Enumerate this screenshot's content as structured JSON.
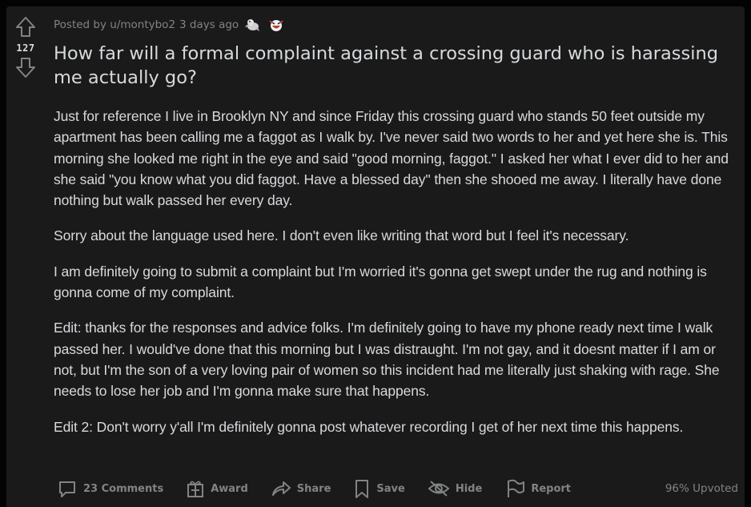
{
  "post": {
    "score": "127",
    "posted_by": "Posted by u/montybo2",
    "age": "3 days ago",
    "title": "How far will a formal complaint against a crossing guard who is harassing me actually go?",
    "paragraphs": [
      "Just for reference I live in Brooklyn NY and since Friday this crossing guard who stands 50 feet outside my apartment has been calling me a faggot as I walk by. I've never said two words to her and yet here she is. This morning she looked me right in the eye and said \"good morning, faggot.\" I asked her what I ever did to her and she said \"you know what you did faggot. Have a blessed day\" then she shooed me away. I literally have done nothing but walk passed her every day.",
      "Sorry about the language used here. I don't even like writing that word but I feel it's necessary.",
      "I am definitely going to submit a complaint but I'm worried it's gonna get swept under the rug and nothing is gonna come of my complaint.",
      "Edit: thanks for the responses and advice folks. I'm definitely going to have my phone ready next time I walk passed her. I would've done that this morning but I was distraught. I'm not gay, and it doesnt matter if I am or not, but I'm the son of a very loving pair of women so this incident had me literally just shaking with rage. She needs to lose her job and I'm gonna make sure that happens.",
      "Edit 2: Don't worry y'all I'm definitely gonna post whatever recording I get of her next time this happens."
    ],
    "awards": [
      "wholesome-seal-award-icon",
      "laughing-face-award-icon"
    ]
  },
  "actions": {
    "comments": "23 Comments",
    "award": "Award",
    "share": "Share",
    "save": "Save",
    "hide": "Hide",
    "report": "Report",
    "upvoted": "96% Upvoted"
  },
  "colors": {
    "background": "#030303",
    "card": "#1a1a1b",
    "text": "#d7dadc",
    "muted": "#818384"
  }
}
